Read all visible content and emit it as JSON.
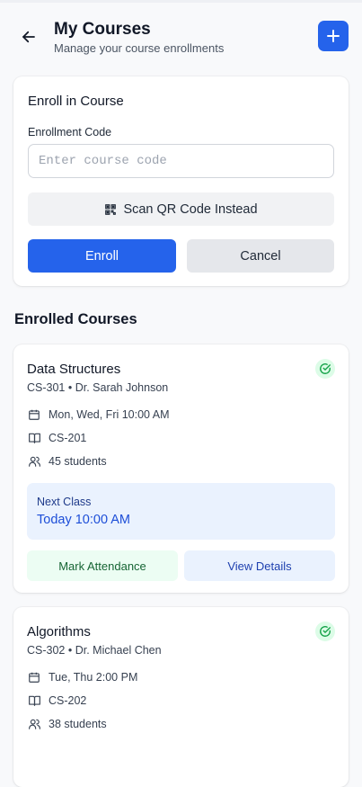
{
  "header": {
    "title": "My Courses",
    "subtitle": "Manage your course enrollments",
    "back_icon": "arrow-left-icon",
    "add_icon": "plus-icon"
  },
  "enroll": {
    "title": "Enroll in Course",
    "field_label": "Enrollment Code",
    "placeholder": "Enter course code",
    "value": "",
    "qr_label": "Scan QR Code Instead",
    "qr_icon": "qr-code-icon",
    "enroll_label": "Enroll",
    "cancel_label": "Cancel"
  },
  "section_title": "Enrolled Courses",
  "courses": [
    {
      "name": "Data Structures",
      "meta": "CS-301 • Dr. Sarah Johnson",
      "schedule": "Mon, Wed, Fri 10:00 AM",
      "room": "CS-201",
      "students": "45 students",
      "next_label": "Next Class",
      "next_time": "Today 10:00 AM",
      "attend_label": "Mark Attendance",
      "details_label": "View Details"
    },
    {
      "name": "Algorithms",
      "meta": "CS-302 • Dr. Michael Chen",
      "schedule": "Tue, Thu 2:00 PM",
      "room": "CS-202",
      "students": "38 students"
    }
  ],
  "colors": {
    "primary": "#2563eb",
    "success_bg": "#dcfce7",
    "success": "#16a34a",
    "info_bg": "#eaf2fe"
  }
}
